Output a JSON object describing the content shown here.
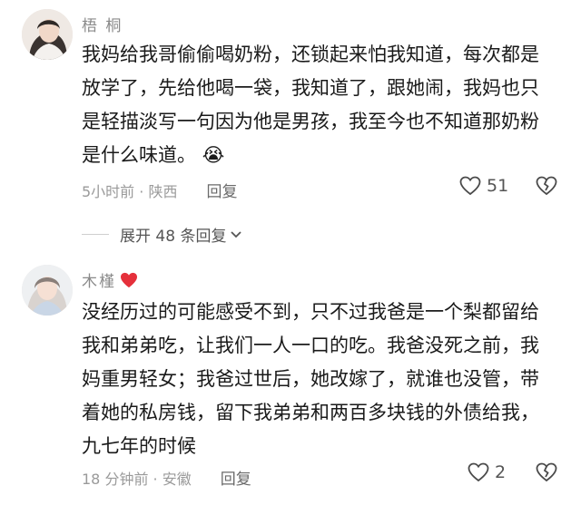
{
  "comments": [
    {
      "username": "梧 桐",
      "text": "我妈给我哥偷偷喝奶粉，还锁起来怕我知道，每次都是放学了，先给他喝一袋，我知道了，跟她闹，我妈也只是轻描淡写一句因为他是男孩，我至今也不知道那奶粉是什么味道。",
      "emoji": "😭",
      "meta": "5小时前 · 陕西",
      "reply_label": "回复",
      "likes": "51",
      "icons": {
        "like": "heart-outline-icon",
        "dislike": "broken-heart-icon"
      }
    },
    {
      "username": "木槿",
      "username_badge": "red-heart-icon",
      "text": "没经历过的可能感受不到，只不过我爸是一个梨都留给我和弟弟吃，让我们一人一口的吃。我爸没死之前，我妈重男轻女；我爸过世后，她改嫁了，就谁也没管，带着她的私房钱，留下我弟弟和两百多块钱的外债给我，九七年的时候",
      "meta": "18 分钟前 · 安徽",
      "reply_label": "回复",
      "likes": "2",
      "icons": {
        "like": "heart-outline-icon",
        "dislike": "broken-heart-icon"
      }
    }
  ],
  "expand_replies": {
    "label": "展开 48 条回复",
    "icon": "chevron-down-icon"
  },
  "colors": {
    "text": "#1a1a1a",
    "meta": "#9a9a9a",
    "badge": "#e5303b"
  }
}
